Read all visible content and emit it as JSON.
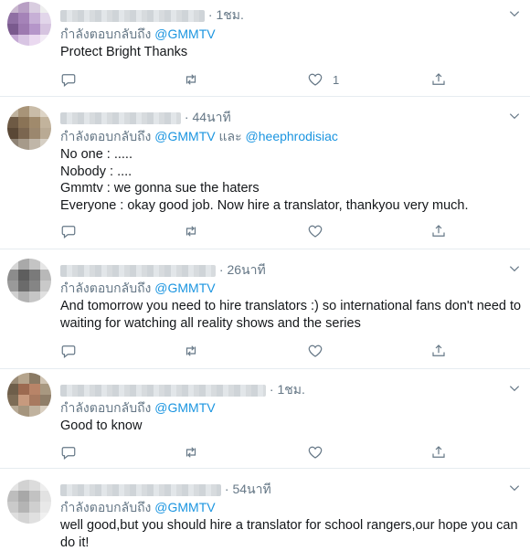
{
  "reply_prefix": "กำลังตอบกลับถึง",
  "icons": {
    "reply": "reply-icon",
    "retweet": "retweet-icon",
    "like": "heart-icon",
    "share": "share-icon",
    "more": "chevron-down-icon"
  },
  "colors": {
    "mention": "#1b95e0",
    "muted": "#657786",
    "text": "#14171a",
    "divider": "#e6ecf0"
  },
  "tweets": [
    {
      "time": "1ชม.",
      "mentions": [
        "@GMMTV"
      ],
      "joiner": "",
      "lines": [
        "Protect Bright Thanks"
      ],
      "likes": "1"
    },
    {
      "time": "44นาที",
      "mentions": [
        "@GMMTV",
        "@heephrodisiac"
      ],
      "joiner": "และ",
      "lines": [
        "No one : .....",
        "Nobody : ....",
        "Gmmtv : we gonna sue the haters",
        "Everyone : okay good job. Now hire a translator, thankyou very much."
      ],
      "likes": ""
    },
    {
      "time": "26นาที",
      "mentions": [
        "@GMMTV"
      ],
      "joiner": "",
      "lines": [
        "And tomorrow you need to hire translators :) so international fans don't need to waiting for watching all reality shows and the series"
      ],
      "likes": ""
    },
    {
      "time": "1ชม.",
      "mentions": [
        "@GMMTV"
      ],
      "joiner": "",
      "lines": [
        "Good to know"
      ],
      "likes": ""
    },
    {
      "time": "54นาที",
      "mentions": [
        "@GMMTV"
      ],
      "joiner": "",
      "lines": [
        "well good,but you should hire a translator for school rangers,our hope you can do it!"
      ],
      "likes": ""
    }
  ]
}
